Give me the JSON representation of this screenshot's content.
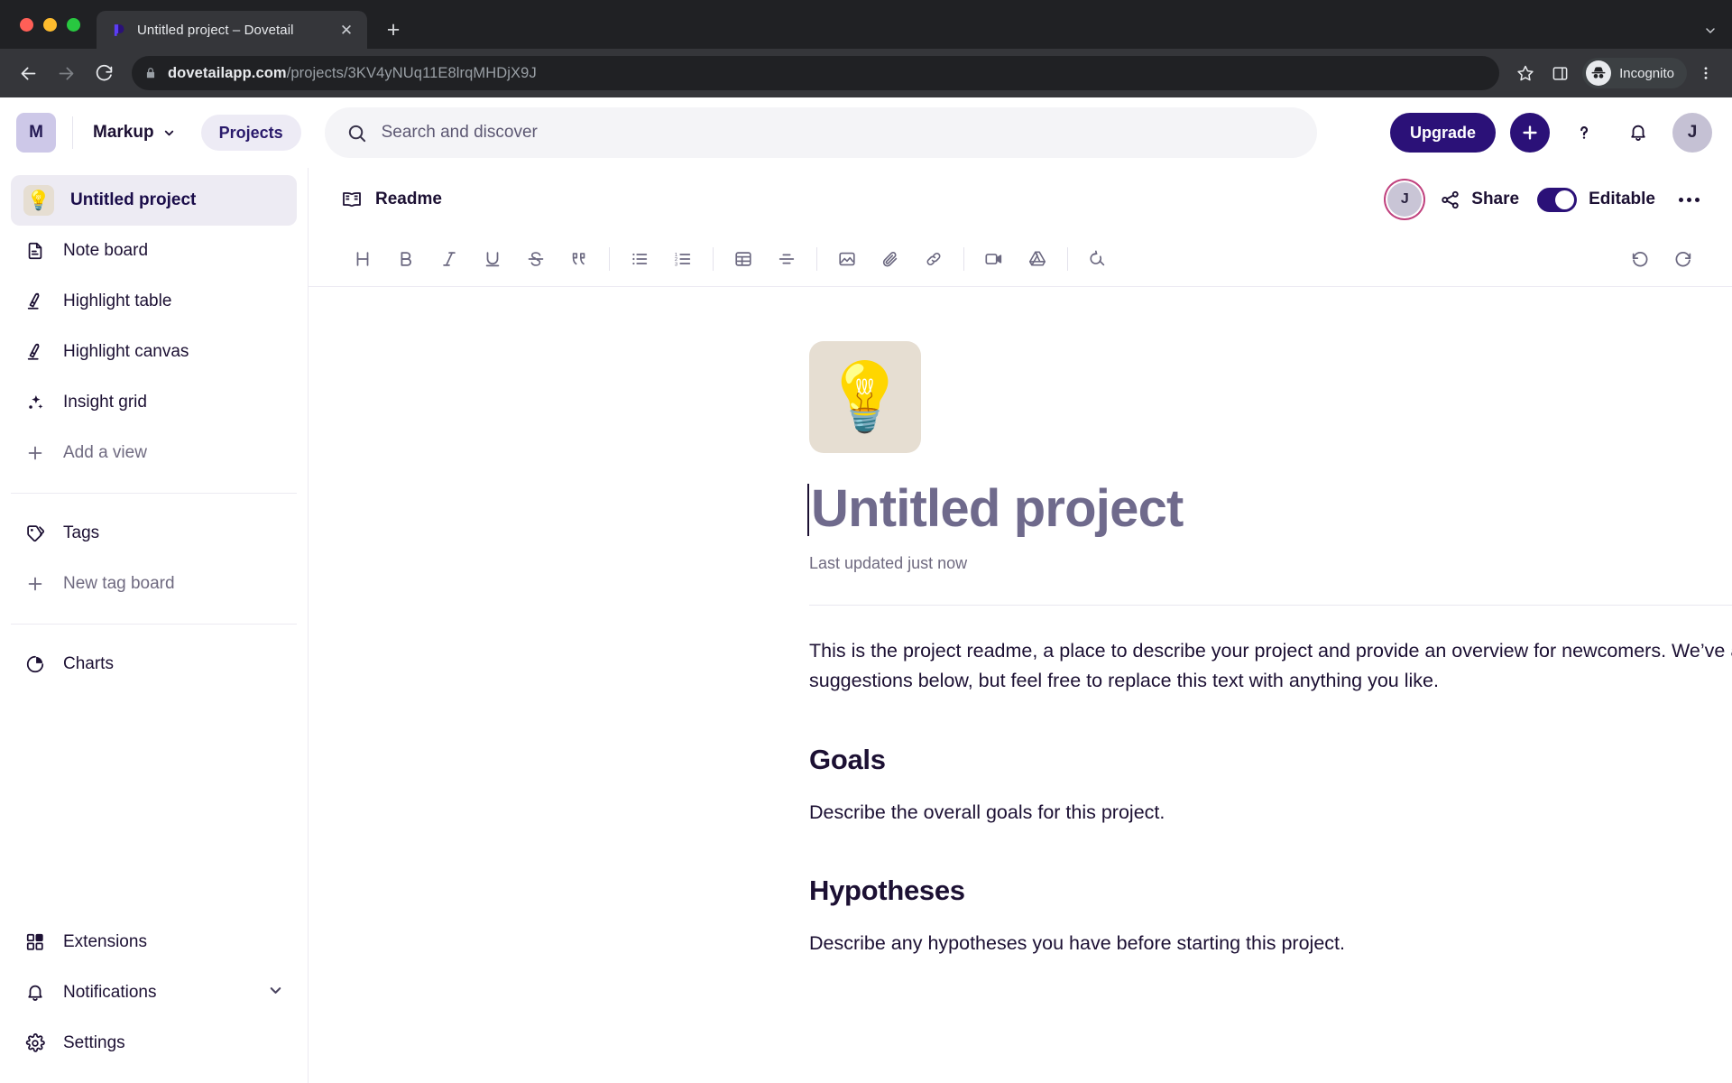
{
  "browser": {
    "tab": {
      "title": "Untitled project – Dovetail",
      "favicon": "dovetail-logo-icon",
      "close_icon": "close-icon"
    },
    "new_tab_icon": "plus-icon",
    "tab_list_icon": "chevron-down-icon",
    "nav": {
      "back_icon": "back-arrow-icon",
      "forward_icon": "forward-arrow-icon",
      "reload_icon": "reload-icon"
    },
    "omnibox": {
      "lock_icon": "lock-icon",
      "url_domain": "dovetailapp.com",
      "url_path": "/projects/3KV4yNUq11E8lrqMHDjX9J"
    },
    "bookmark_icon": "star-icon",
    "sidepanel_icon": "side-panel-icon",
    "incognito": {
      "label": "Incognito",
      "icon": "incognito-icon"
    },
    "menu_icon": "kebab-menu-icon"
  },
  "appbar": {
    "workspace_badge": "M",
    "workspace_name": "Markup",
    "workspace_chevron": "chevron-down-icon",
    "projects_label": "Projects",
    "search": {
      "placeholder": "Search and discover",
      "icon": "search-icon"
    },
    "upgrade_label": "Upgrade",
    "create_icon": "plus-icon",
    "help_icon": "question-mark-icon",
    "notifications_icon": "bell-icon",
    "avatar_initial": "J"
  },
  "sidebar": {
    "views": [
      {
        "label": "Untitled project",
        "icon": "lightbulb-emoji-icon",
        "active": true
      },
      {
        "label": "Note board",
        "icon": "note-icon",
        "active": false
      },
      {
        "label": "Highlight table",
        "icon": "highlighter-icon",
        "active": false
      },
      {
        "label": "Highlight canvas",
        "icon": "highlighter-icon",
        "active": false
      },
      {
        "label": "Insight grid",
        "icon": "sparkle-icon",
        "active": false
      },
      {
        "label": "Add a view",
        "icon": "plus-icon",
        "active": false,
        "muted": true
      }
    ],
    "tags": [
      {
        "label": "Tags",
        "icon": "tag-icon",
        "muted": false
      },
      {
        "label": "New tag board",
        "icon": "plus-icon",
        "muted": true
      }
    ],
    "charts": [
      {
        "label": "Charts",
        "icon": "pie-chart-icon",
        "muted": false
      }
    ],
    "bottom": [
      {
        "label": "Extensions",
        "icon": "extensions-icon",
        "chevron": false
      },
      {
        "label": "Notifications",
        "icon": "bell-icon",
        "chevron": true
      },
      {
        "label": "Settings",
        "icon": "gear-icon",
        "chevron": false
      }
    ]
  },
  "content_header": {
    "tab_label": "Readme",
    "tab_icon": "book-icon",
    "avatar_initial": "J",
    "share_label": "Share",
    "share_icon": "share-nodes-icon",
    "editable_label": "Editable",
    "editable_on": true,
    "more_icon": "ellipsis-icon"
  },
  "editor_toolbar": {
    "groups": [
      [
        {
          "name": "heading-button",
          "glyph": "H"
        },
        {
          "name": "bold-button",
          "glyph": "B"
        },
        {
          "name": "italic-button",
          "glyph": "I"
        },
        {
          "name": "underline-button",
          "glyph": "U"
        },
        {
          "name": "strikethrough-button",
          "glyph": "S"
        },
        {
          "name": "quote-button",
          "glyph": "99"
        }
      ],
      [
        {
          "name": "bulleted-list-button",
          "glyph": "list"
        },
        {
          "name": "numbered-list-button",
          "glyph": "ordered-list"
        }
      ],
      [
        {
          "name": "table-button",
          "glyph": "table"
        },
        {
          "name": "divider-button",
          "glyph": "divider"
        }
      ],
      [
        {
          "name": "image-button",
          "glyph": "image"
        },
        {
          "name": "attachment-button",
          "glyph": "paperclip"
        },
        {
          "name": "link-button",
          "glyph": "link"
        }
      ],
      [
        {
          "name": "video-button",
          "glyph": "video"
        },
        {
          "name": "google-drive-button",
          "glyph": "drive"
        }
      ],
      [
        {
          "name": "find-button",
          "glyph": "find"
        }
      ]
    ],
    "undo_icon": "undo-icon",
    "redo_icon": "redo-icon"
  },
  "document": {
    "emoji": "💡",
    "title": "Untitled project",
    "last_updated": "Last updated just now",
    "intro": "This is the project readme, a place to describe your project and provide an overview for newcomers. We’ve added some suggestions below, but feel free to replace this text with anything you like.",
    "sections": [
      {
        "heading": "Goals",
        "body": "Describe the overall goals for this project."
      },
      {
        "heading": "Hypotheses",
        "body": "Describe any hypotheses you have before starting this project."
      }
    ]
  },
  "colors": {
    "brand_purple": "#2b1178",
    "accent_pill": "#edebf5",
    "emoji_tile": "#e6ded2",
    "title_placeholder": "#6f6a8c",
    "ring_pink": "#c0417e"
  }
}
